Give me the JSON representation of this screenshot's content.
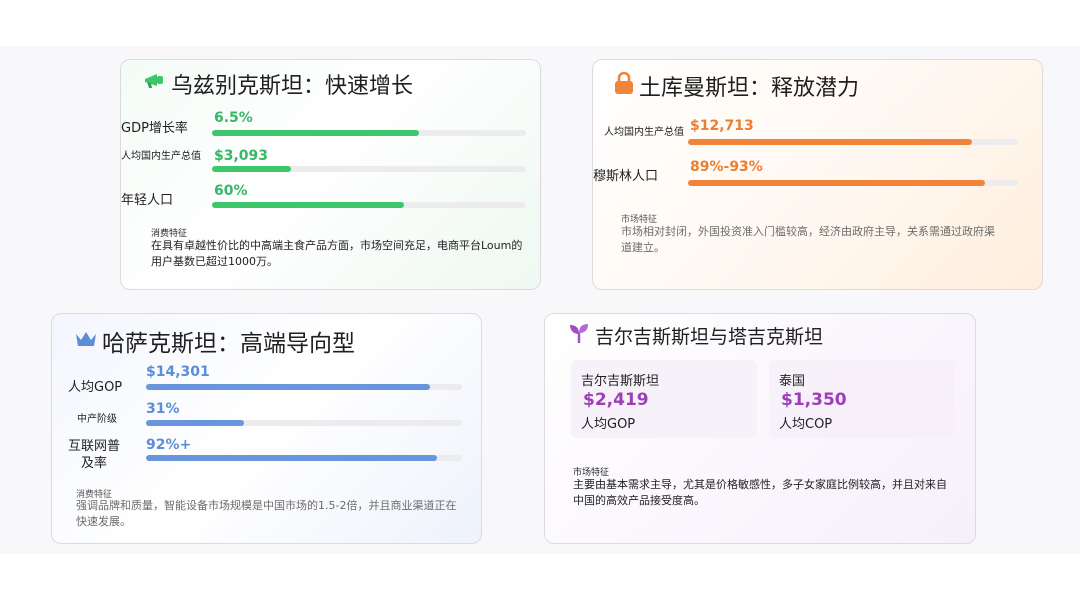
{
  "uzbekistan": {
    "icon": "megaphone-icon",
    "title": "乌兹别克斯坦：快速增长",
    "metrics": [
      {
        "label": "GDP增长率",
        "value": "6.5%",
        "level": 0.66
      },
      {
        "label": "人均国内生产总值",
        "value": "$3,093",
        "level": 0.25
      },
      {
        "label": "年轻人口",
        "value": "60%",
        "level": 0.61
      }
    ],
    "feature_heading": "消费特征",
    "feature_text": "在具有卓越性价比的中高端主食产品方面，市场空间充足，电商平台Loum的用户基数已超过1000万。"
  },
  "turkmenistan": {
    "icon": "lock-icon",
    "title": "土库曼斯坦：释放潜力",
    "metrics": [
      {
        "label": "人均国内生产总值",
        "value": "$12,713",
        "level": 0.86
      },
      {
        "label": "穆斯林人口",
        "value": "89%-93%",
        "level": 0.9
      }
    ],
    "feature_heading": "市场特征",
    "feature_text": "市场相对封闭，外国投资准入门槛较高，经济由政府主导，关系需通过政府渠道建立。"
  },
  "kazakhstan": {
    "icon": "crown-icon",
    "title": "哈萨克斯坦：高端导向型",
    "metrics": [
      {
        "label": "人均GOP",
        "value": "$14,301",
        "level": 0.9
      },
      {
        "label": "中产阶级",
        "value": "31%",
        "level": 0.31
      },
      {
        "label": "互联网普及率",
        "value": "92%+",
        "level": 0.92
      }
    ],
    "feature_heading": "消费特征",
    "feature_text": "强调品牌和质量，智能设备市场规模是中国市场的1.5-2倍，并且商业渠道正在快速发展。"
  },
  "kyrgyz_tajik": {
    "icon": "sprout-icon",
    "title": "吉尔吉斯斯坦与塔吉克斯坦",
    "boxes": [
      {
        "name": "吉尔吉斯斯坦",
        "value": "$2,419",
        "caption": "人均GOP"
      },
      {
        "name": "泰国",
        "value": "$1,350",
        "caption": "人均COP"
      }
    ],
    "feature_heading": "市场特征",
    "feature_text": "主要由基本需求主导，尤其是价格敏感性，多子女家庭比例较高，并且对来自中国的高效产品接受度高。"
  },
  "colors": {
    "green": "#3ec66a",
    "orange": "#f0843a",
    "blue": "#6796dc",
    "purple": "#9c3fb6"
  }
}
